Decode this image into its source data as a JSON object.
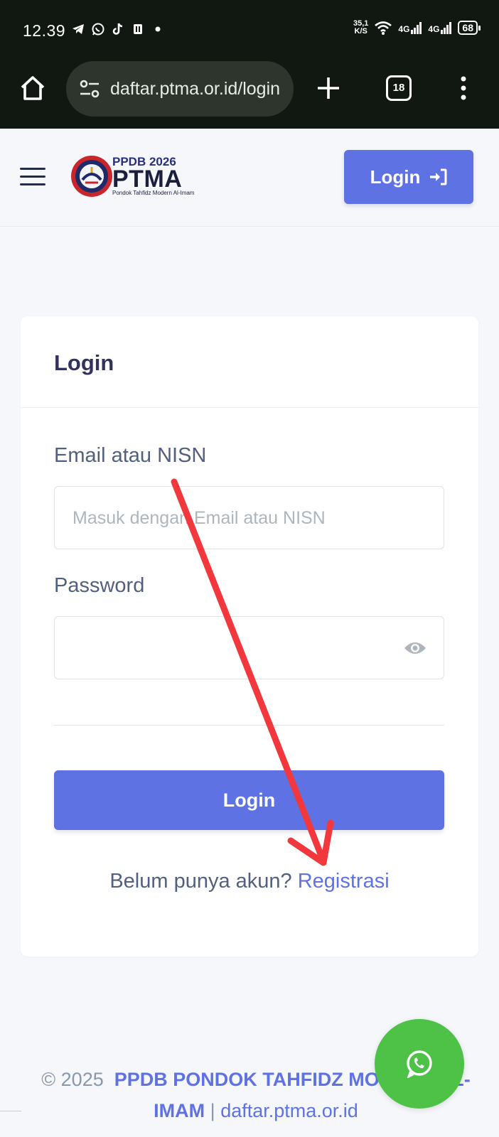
{
  "status_bar": {
    "time": "12.39",
    "net_speed_value": "35,1",
    "net_speed_unit": "K/S",
    "network_1": "4G",
    "network_2": "4G",
    "battery": "68"
  },
  "browser": {
    "url": "daftar.ptma.or.id/login",
    "tab_count": "18"
  },
  "navbar": {
    "logo_top": "PPDB 2026",
    "logo_main": "PTMA",
    "logo_sub": "Pondok Tahfidz Modern Al-Imam",
    "login_label": "Login"
  },
  "card": {
    "title": "Login",
    "email_label": "Email atau NISN",
    "email_placeholder": "Masuk dengan Email atau NISN",
    "password_label": "Password",
    "submit_label": "Login",
    "register_prompt": "Belum punya akun?",
    "register_link": "Registrasi"
  },
  "footer": {
    "copyright": "© 2025",
    "brand": "PPDB PONDOK TAHFIDZ MODERN AL-IMAM",
    "separator": "|",
    "domain": "daftar.ptma.or.id"
  },
  "colors": {
    "primary": "#5e72e4",
    "whatsapp": "#4dc247",
    "annotation_arrow": "#f2383c",
    "chrome_bg": "#111811"
  },
  "icons": {
    "home": "home-icon",
    "site_settings": "tune-icon",
    "new_tab": "plus-icon",
    "menu": "more-vertical-icon",
    "hamburger": "hamburger-menu-icon",
    "login": "sign-in-icon",
    "password_toggle": "eye-icon",
    "chat": "whatsapp-icon"
  }
}
